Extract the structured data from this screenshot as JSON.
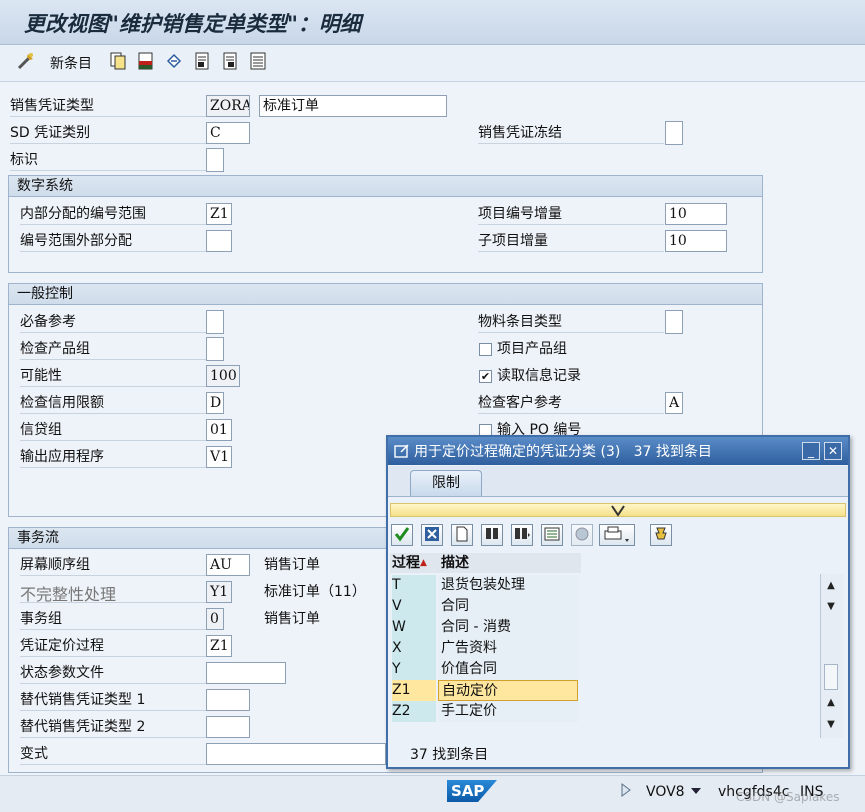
{
  "window": {
    "title": "更改视图\"维护销售定单类型\"：明细"
  },
  "toolbar": {
    "new_entries": "新条目"
  },
  "header": {
    "doc_type_label": "销售凭证类型",
    "doc_type_code": "ZORA",
    "doc_type_desc": "标准订单",
    "sd_cat_label": "SD 凭证类别",
    "sd_cat_value": "C",
    "freeze_label": "销售凭证冻结",
    "indicator_label": "标识"
  },
  "number_system": {
    "title": "数字系统",
    "internal_range_label": "内部分配的编号范围",
    "internal_range_value": "Z1",
    "external_range_label": "编号范围外部分配",
    "item_incr_label": "项目编号增量",
    "item_incr_value": "10",
    "subitem_incr_label": "子项目增量",
    "subitem_incr_value": "10"
  },
  "general_control": {
    "title": "一般控制",
    "ref_mandatory_label": "必备参考",
    "check_division_label": "检查产品组",
    "probability_label": "可能性",
    "probability_value": "100",
    "check_credit_label": "检查信用限额",
    "check_credit_value": "D",
    "credit_group_label": "信贷组",
    "credit_group_value": "01",
    "output_app_label": "输出应用程序",
    "output_app_value": "V1",
    "material_entry_label": "物料条目类型",
    "item_division_label": "项目产品组",
    "read_info_label": "读取信息记录",
    "check_cust_ref_label": "检查客户参考",
    "check_cust_ref_value": "A",
    "enter_po_label": "输入 PO 编号"
  },
  "transaction_flow": {
    "title": "事务流",
    "screen_seq_label": "屏幕顺序组",
    "screen_seq_value": "AU",
    "screen_seq_desc": "销售订单",
    "incompletion_label": "不完整性处理",
    "incompletion_value": "Y1",
    "incompletion_desc": "标准订单（11）",
    "trans_group_label": "事务组",
    "trans_group_value": "0",
    "trans_group_desc": "销售订单",
    "pricing_proc_label": "凭证定价过程",
    "pricing_proc_value": "Z1",
    "status_profile_label": "状态参数文件",
    "alt_doc1_label": "替代销售凭证类型 1",
    "alt_doc2_label": "替代销售凭证类型 2",
    "variant_label": "变式"
  },
  "dialog": {
    "title": "用于定价过程确定的凭证分类 (3)",
    "found": "37 找到条目",
    "tab": "限制",
    "col_key": "过程",
    "col_desc": "描述",
    "rows": [
      {
        "key": "T",
        "desc": "退货包装处理"
      },
      {
        "key": "V",
        "desc": "合同"
      },
      {
        "key": "W",
        "desc": "合同 - 消费"
      },
      {
        "key": "X",
        "desc": "广告资料"
      },
      {
        "key": "Y",
        "desc": "价值合同"
      },
      {
        "key": "Z1",
        "desc": "自动定价"
      },
      {
        "key": "Z2",
        "desc": "手工定价"
      }
    ],
    "status": "37 找到条目"
  },
  "statusbar": {
    "sap_logo": "SAP",
    "transaction": "VOV8",
    "server": "vhcgfds4c",
    "mode": "INS",
    "watermark": "CSDN @Saplakes"
  },
  "colors": {
    "accent": "#2f5f9e",
    "selected": "#ffe7a0"
  }
}
